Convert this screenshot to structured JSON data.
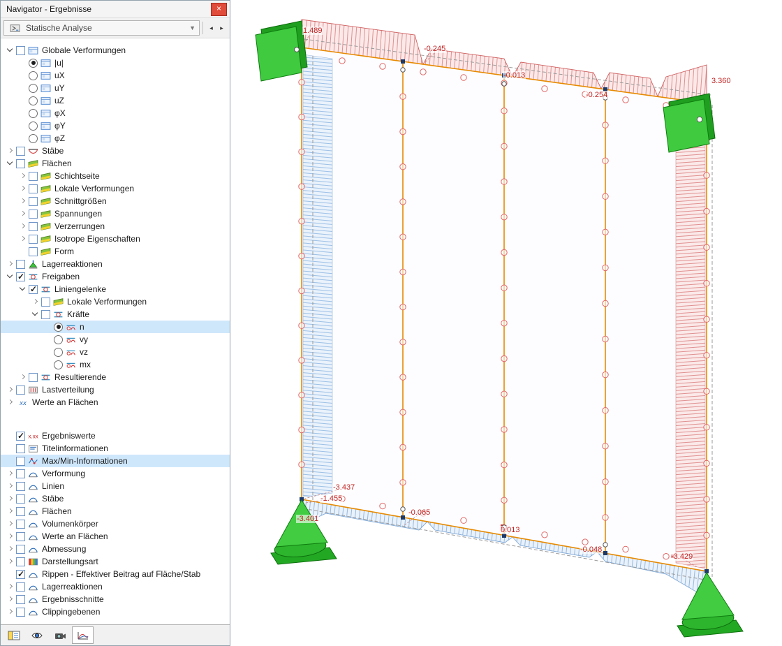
{
  "window": {
    "title": "Navigator - Ergebnisse",
    "close_label": "×"
  },
  "toolbar": {
    "combo_value": "Statische Analyse",
    "prev_label": "◂",
    "next_label": "▸"
  },
  "tree_top": {
    "items": [
      {
        "label": "Globale Verformungen"
      },
      {
        "label": "|u|"
      },
      {
        "label": "uX"
      },
      {
        "label": "uY"
      },
      {
        "label": "uZ"
      },
      {
        "label": "φX"
      },
      {
        "label": "φY"
      },
      {
        "label": "φZ"
      },
      {
        "label": "Stäbe"
      },
      {
        "label": "Flächen"
      },
      {
        "label": "Schichtseite"
      },
      {
        "label": "Lokale Verformungen"
      },
      {
        "label": "Schnittgrößen"
      },
      {
        "label": "Spannungen"
      },
      {
        "label": "Verzerrungen"
      },
      {
        "label": "Isotrope Eigenschaften"
      },
      {
        "label": "Form"
      },
      {
        "label": "Lagerreaktionen"
      },
      {
        "label": "Freigaben"
      },
      {
        "label": "Liniengelenke"
      },
      {
        "label": "Lokale Verformungen"
      },
      {
        "label": "Kräfte"
      },
      {
        "label": "n"
      },
      {
        "label": "vy"
      },
      {
        "label": "vz"
      },
      {
        "label": "mx"
      },
      {
        "label": "Resultierende"
      },
      {
        "label": "Lastverteilung"
      },
      {
        "label": "Werte an Flächen"
      }
    ]
  },
  "tree_bottom": {
    "items": [
      {
        "label": "Ergebniswerte"
      },
      {
        "label": "Titelinformationen"
      },
      {
        "label": "Max/Min-Informationen"
      },
      {
        "label": "Verformung"
      },
      {
        "label": "Linien"
      },
      {
        "label": "Stäbe"
      },
      {
        "label": "Flächen"
      },
      {
        "label": "Volumenkörper"
      },
      {
        "label": "Werte an Flächen"
      },
      {
        "label": "Abmessung"
      },
      {
        "label": "Darstellungsart"
      },
      {
        "label": "Rippen - Effektiver Beitrag auf Fläche/Stab"
      },
      {
        "label": "Lagerreaktionen"
      },
      {
        "label": "Ergebnisschnitte"
      },
      {
        "label": "Clippingebenen"
      }
    ]
  },
  "tabs": {
    "items": [
      {
        "icon": "data-navigator-icon"
      },
      {
        "icon": "display-eye-icon"
      },
      {
        "icon": "views-camera-icon"
      },
      {
        "icon": "results-diagram-icon"
      }
    ],
    "active_index": 3
  },
  "viewport": {
    "values": [
      "1.489",
      "-0.245",
      "-0.013",
      "-0.254",
      "3.360",
      "-3.437",
      "-1.455",
      "-3.401",
      "-0.065",
      "0.013",
      "-0.048",
      "-3.429"
    ]
  },
  "colors": {
    "selection": "#cfe7fb",
    "result_positive_red": "#c22222",
    "result_negative_blue": "#7fa8d6",
    "hinge_orange": "#e78a00",
    "support_green": "#3fca3f",
    "close_button_red": "#e14b39"
  }
}
